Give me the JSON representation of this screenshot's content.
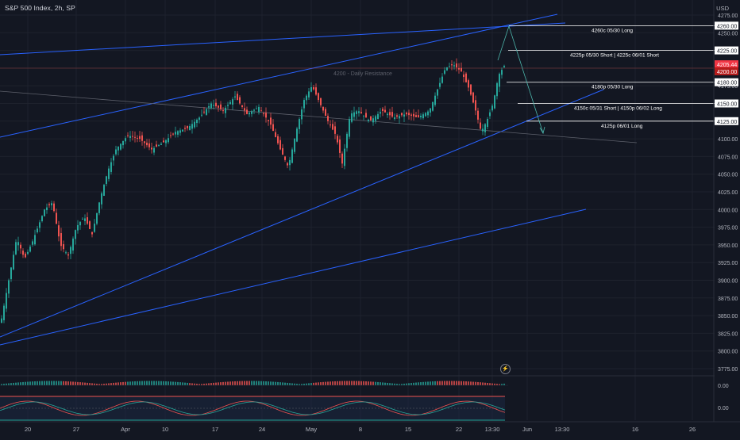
{
  "header": {
    "title": "S&P 500 Index, 2h, SP",
    "currency": "USD"
  },
  "price_axis": {
    "ticks": [
      "4275.00",
      "4250.00",
      "4225.00",
      "4200.00",
      "4175.00",
      "4150.00",
      "4125.00",
      "4100.00",
      "4075.00",
      "4050.00",
      "4025.00",
      "4000.00",
      "3975.00",
      "3950.00",
      "3925.00",
      "3900.00",
      "3875.00",
      "3850.00",
      "3825.00",
      "3800.00",
      "3775.00"
    ],
    "current_price": "4205.44",
    "current_price_color": "#f23645",
    "crosshair_price": "4200.00"
  },
  "time_axis": {
    "labels": [
      "20",
      "27",
      "Apr",
      "10",
      "17",
      "24",
      "May",
      "8",
      "15",
      "22",
      "13:30",
      "Jun",
      "13:30",
      "16",
      "26"
    ]
  },
  "resistance_label": "4200 - Daily Resistance",
  "levels": [
    {
      "price": "4260.00",
      "text": "4260c 05/30 Long"
    },
    {
      "price": "4225.00",
      "text": "4225p 05/30 Short | 4225c 06/01 Short"
    },
    {
      "price": "4180.00",
      "text": "4180p 05/30 Long"
    },
    {
      "price": "4150.00",
      "text": "4150c 05/31 Short | 4150p 06/02 Long"
    },
    {
      "price": "4125.00",
      "text": "4125p 06/01 Long"
    }
  ],
  "indicators": {
    "histogram_value": "0.00",
    "oscillator_value": "0.00"
  },
  "colors": {
    "background": "#131722",
    "up_candle": "#26a69a",
    "down_candle": "#ef5350",
    "trendline": "#2962ff",
    "projection": "#4db6ac",
    "level_line": "#ffffff"
  },
  "icons": {
    "alert": "lightning-icon"
  }
}
